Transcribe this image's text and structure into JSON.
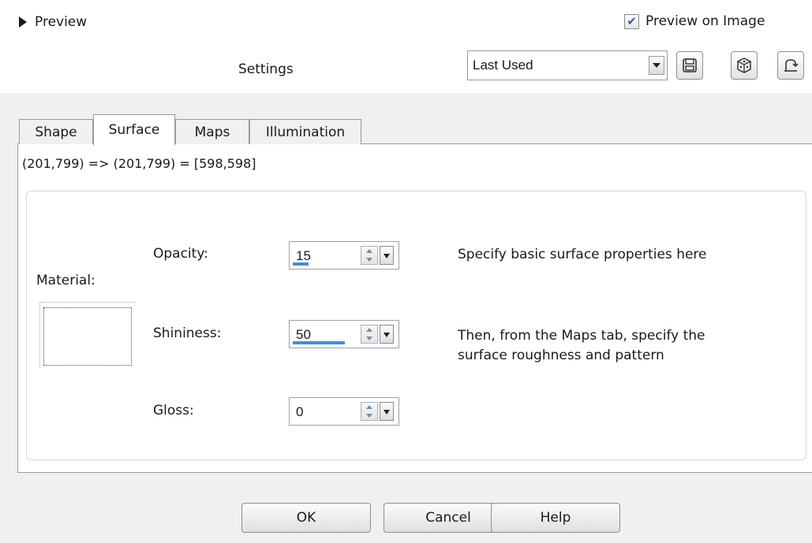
{
  "header": {
    "preview_label": "Preview",
    "preview_on_image_label": "Preview on Image",
    "preview_on_image_checked": true,
    "settings_label": "Settings",
    "preset_value": "Last Used",
    "icons": [
      "save-icon",
      "randomize-dice-icon",
      "reset-icon"
    ]
  },
  "tabs": [
    {
      "label": "Shape",
      "active": false
    },
    {
      "label": "Surface",
      "active": true
    },
    {
      "label": "Maps",
      "active": false
    },
    {
      "label": "Illumination",
      "active": false
    }
  ],
  "coords_text": "(201,799) => (201,799) = [598,598]",
  "surface": {
    "material_label": "Material:",
    "fields": [
      {
        "label": "Opacity:",
        "value": "15",
        "level_percent": 15
      },
      {
        "label": "Shininess:",
        "value": "50",
        "level_percent": 50
      },
      {
        "label": "Gloss:",
        "value": "0",
        "level_percent": 0
      }
    ],
    "help_line1": "Specify basic surface properties here",
    "help_line2a": "Then, from the Maps tab, specify the",
    "help_line2b": "surface roughness and pattern"
  },
  "buttons": {
    "ok": "OK",
    "cancel": "Cancel",
    "help": "Help"
  },
  "colors": {
    "accent": "#3b8fe0",
    "background": "#f0f0f0",
    "panel": "#ffffff"
  }
}
